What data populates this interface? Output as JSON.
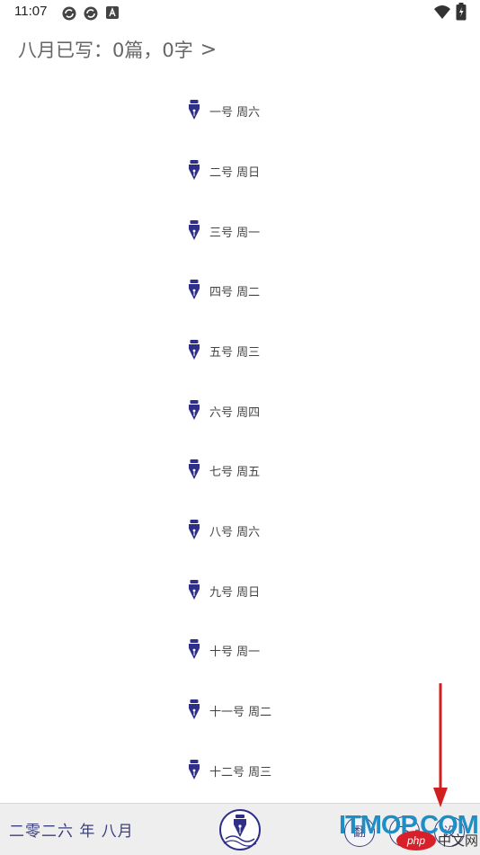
{
  "status_bar": {
    "time": "11:07",
    "icons": [
      "sync-icon",
      "sync-icon",
      "notification-a-icon",
      "wifi-icon",
      "battery-charging-icon"
    ]
  },
  "header": {
    "summary": "八月已写：0篇，0字",
    "chevron": ">"
  },
  "days": [
    {
      "label": "一号 周六"
    },
    {
      "label": "二号 周日"
    },
    {
      "label": "三号 周一"
    },
    {
      "label": "四号 周二"
    },
    {
      "label": "五号 周三"
    },
    {
      "label": "六号 周四"
    },
    {
      "label": "七号 周五"
    },
    {
      "label": "八号 周六"
    },
    {
      "label": "九号 周日"
    },
    {
      "label": "十号 周一"
    },
    {
      "label": "十一号 周二"
    },
    {
      "label": "十二号 周三"
    }
  ],
  "bottom_bar": {
    "month_label": "二零二六 年 八月",
    "buttons": [
      {
        "label": "翻",
        "name": "flip-button"
      },
      {
        "label": "下",
        "name": "next-button"
      },
      {
        "label": "设",
        "name": "settings-button"
      }
    ]
  },
  "watermark": {
    "main": "ITMOP.COM",
    "php": "php",
    "cn": "中文网"
  },
  "colors": {
    "accent": "#3a3f7a",
    "pen": "#2f2f8a",
    "arrow": "#d11f1f"
  }
}
